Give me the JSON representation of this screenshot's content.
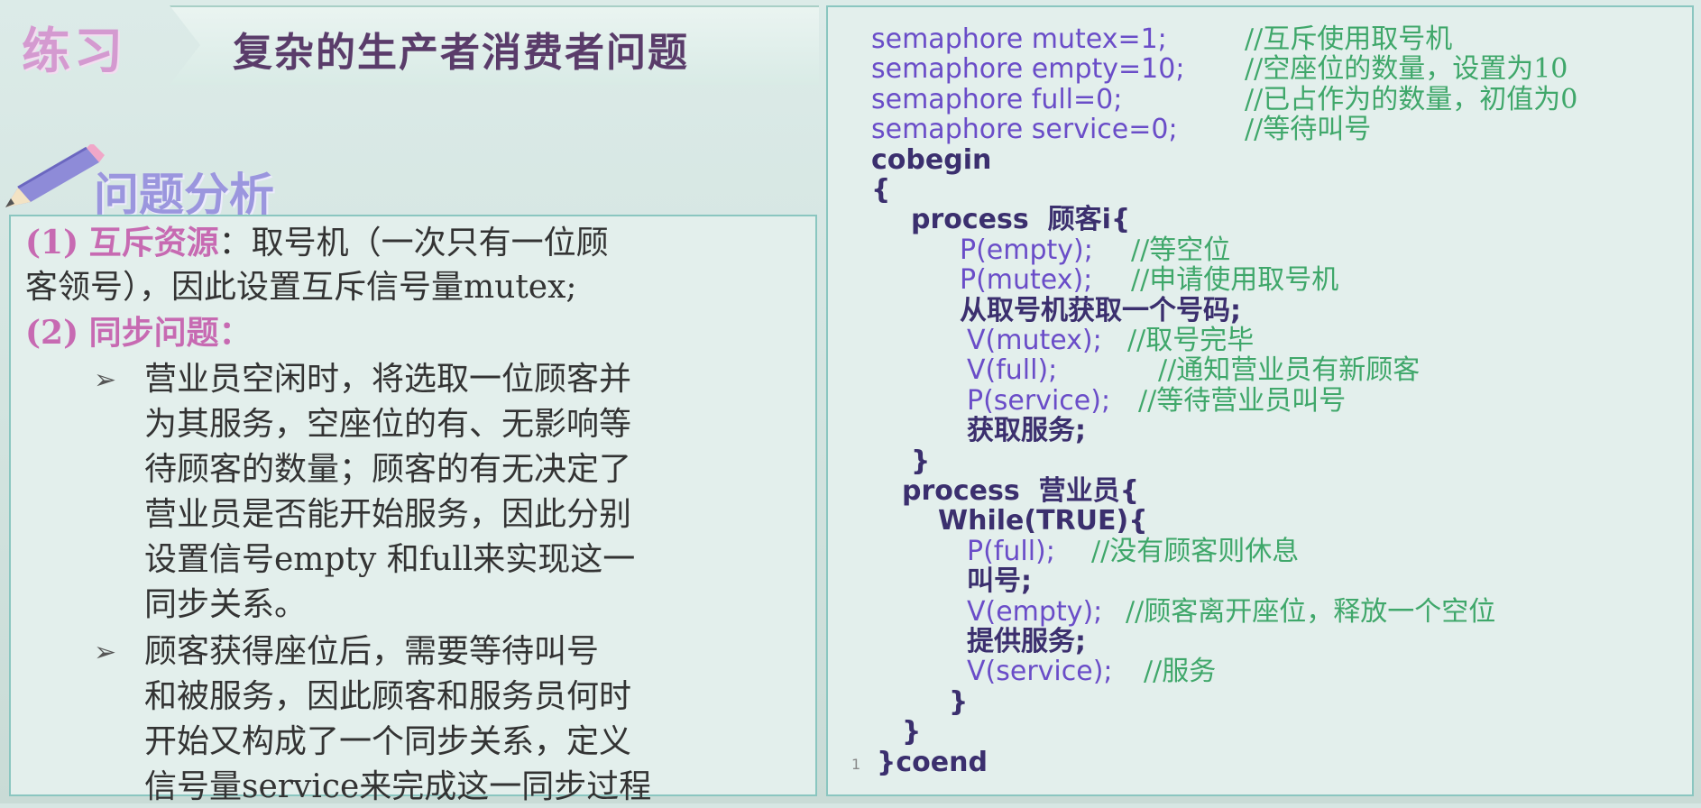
{
  "header": {
    "tag": "练习",
    "title": "复杂的生产者消费者问题"
  },
  "analysis": {
    "heading": "问题分析",
    "lines": [
      {
        "prefix": "(1)",
        "highlight": "互斥资源",
        "rest": "：取号机（一次只有一位顾"
      },
      {
        "text": "客领号），因此设置互斥信号量mutex;"
      },
      {
        "prefix": "(2)",
        "highlight": "同步问题",
        "rest": "："
      },
      {
        "bullet": "➢",
        "text": "营业员空闲时，将选取一位顾客并"
      },
      {
        "text": "为其服务，空座位的有、无影响等"
      },
      {
        "text": "待顾客的数量；顾客的有无决定了"
      },
      {
        "text": "营业员是否能开始服务，因此分别"
      },
      {
        "text": "设置信号empty 和full来实现这一"
      },
      {
        "text": "同步关系。"
      },
      {
        "bullet": "➢",
        "text": "顾客获得座位后，需要等待叫号"
      },
      {
        "text": "和被服务，因此顾客和服务员何时"
      },
      {
        "text": "开始又构成了一个同步关系，定义"
      },
      {
        "text": "信号量service来完成这一同步过程"
      }
    ]
  },
  "code": {
    "page_number": "1",
    "lines": [
      {
        "code": "semaphore mutex=1;",
        "comment": "//互斥使用取号机"
      },
      {
        "code": "semaphore empty=10;",
        "comment": "//空座位的数量，设置为10"
      },
      {
        "code": "semaphore full=0;",
        "comment": "//已占作为的数量，初值为0"
      },
      {
        "code": "semaphore service=0;",
        "comment": "//等待叫号"
      },
      {
        "code": "cobegin",
        "comment": ""
      },
      {
        "code": "{",
        "comment": ""
      },
      {
        "code": "process  顾客i{",
        "comment": ""
      },
      {
        "code": "P(empty);",
        "comment": "//等空位"
      },
      {
        "code": "P(mutex);",
        "comment": "//申请使用取号机"
      },
      {
        "code": "从取号机获取一个号码;",
        "comment": ""
      },
      {
        "code": "V(mutex);",
        "comment": "//取号完毕"
      },
      {
        "code": "V(full);",
        "comment": "//通知营业员有新顾客"
      },
      {
        "code": "P(service);",
        "comment": "//等待营业员叫号"
      },
      {
        "code": "获取服务;",
        "comment": ""
      },
      {
        "code": "}",
        "comment": ""
      },
      {
        "code": "process  营业员{",
        "comment": ""
      },
      {
        "code": "While(TRUE){",
        "comment": ""
      },
      {
        "code": "P(full);",
        "comment": "//没有顾客则休息"
      },
      {
        "code": "叫号;",
        "comment": ""
      },
      {
        "code": "V(empty);",
        "comment": "//顾客离开座位，释放一个空位"
      },
      {
        "code": "提供服务;",
        "comment": ""
      },
      {
        "code": "V(service);",
        "comment": "//服务"
      },
      {
        "code": "}",
        "comment": ""
      },
      {
        "code": "}",
        "comment": ""
      },
      {
        "code": "}coend",
        "comment": ""
      }
    ]
  }
}
